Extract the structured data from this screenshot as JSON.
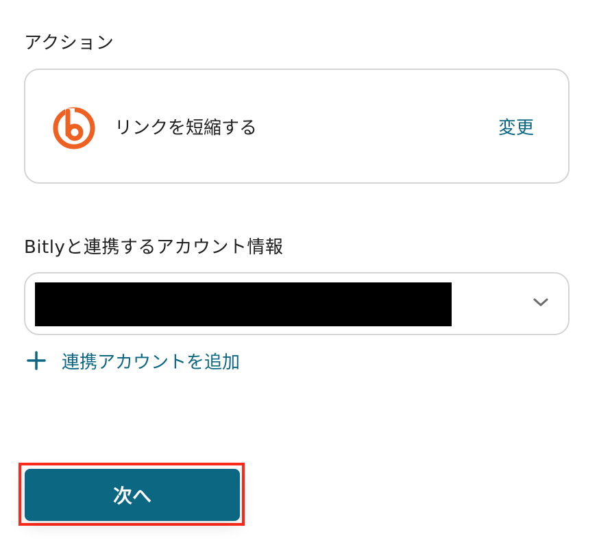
{
  "action_section": {
    "label": "アクション",
    "app_icon": "bitly-logo-icon",
    "action_name": "リンクを短縮する",
    "change_label": "変更"
  },
  "account_section": {
    "label": "Bitlyと連携するアカウント情報",
    "selected_value": "",
    "dropdown_icon": "chevron-down-icon",
    "add_account_icon": "plus-icon",
    "add_account_label": "連携アカウントを追加"
  },
  "footer": {
    "next_label": "次へ"
  },
  "colors": {
    "accent": "#0c6782",
    "brand_bitly": "#ee6123",
    "highlight": "#ff2a1a",
    "border": "#d4d4d4"
  }
}
